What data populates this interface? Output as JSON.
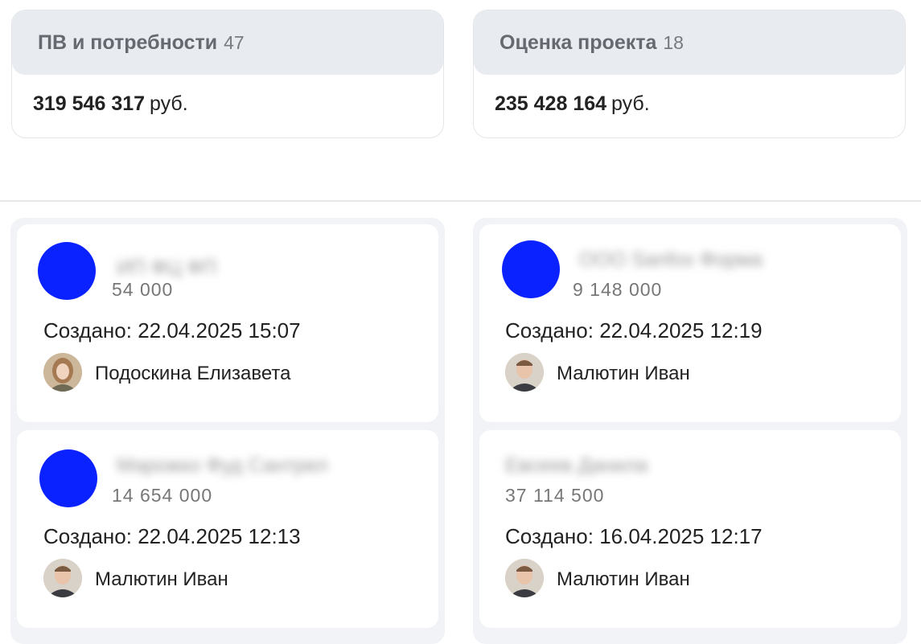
{
  "stages": [
    {
      "title": "ПВ и потребности",
      "count": "47",
      "sum": "319 546 317",
      "currency": "руб."
    },
    {
      "title": "Оценка проекта",
      "count": "18",
      "sum": "235 428 164",
      "currency": "руб."
    }
  ],
  "deals": [
    {
      "name": "ИП ФЦ ФП",
      "amount": "54 000",
      "created": "Создано: 22.04.2025 15:07",
      "owner": "Подоскина Елизавета",
      "avatar_color": "#0a22ff"
    },
    {
      "name": "ООО Sanfox Форма",
      "amount": "9 148 000",
      "created": "Создано: 22.04.2025 12:19",
      "owner": "Малютин Иван",
      "avatar_color": "#0a22ff"
    },
    {
      "name": "Марожко Фуд Сантрел",
      "amount": "14 654 000",
      "created": "Создано: 22.04.2025 12:13",
      "owner": "Малютин Иван",
      "avatar_color": "#0a22ff"
    },
    {
      "name": "Евсеев Данила",
      "amount": "37 114 500",
      "created": "Создано: 16.04.2025 12:17",
      "owner": "Малютин Иван",
      "avatar_color": null
    }
  ]
}
